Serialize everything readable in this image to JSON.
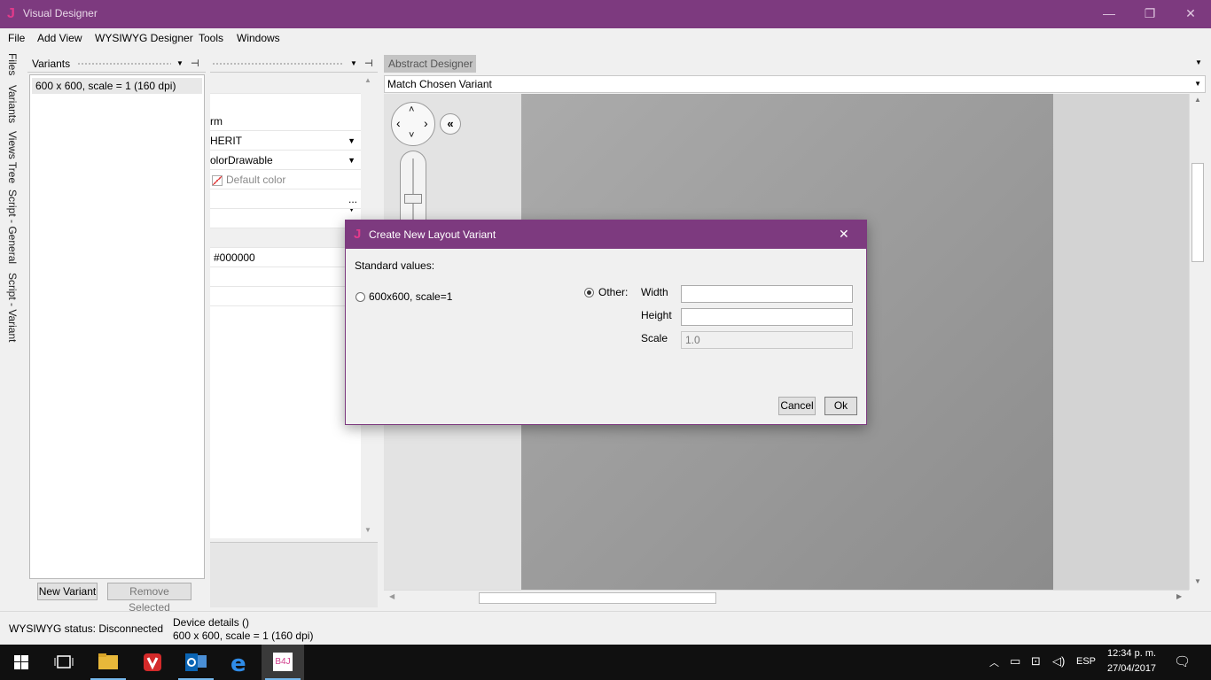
{
  "window": {
    "title": "Visual Designer",
    "app_icon_glyph": "J",
    "minimize_glyph": "—",
    "restore_glyph": "❐",
    "close_glyph": "✕"
  },
  "menu": [
    "File",
    "Add View",
    "WYSIWYG Designer",
    "Tools",
    "Windows"
  ],
  "side_tabs": [
    "Files",
    "Variants",
    "Views Tree",
    "Script - General",
    "Script - Variant"
  ],
  "variants_panel": {
    "title": "Variants",
    "items": [
      "600 x 600, scale = 1 (160 dpi)"
    ],
    "new_button": "New Variant",
    "remove_button": "Remove Selected"
  },
  "properties_panel": {
    "rows": [
      {
        "value": ""
      },
      {
        "value": "rm"
      },
      {
        "value": "HERIT",
        "dropdown": true
      },
      {
        "value": "olorDrawable",
        "dropdown": true
      },
      {
        "value": "Default color"
      },
      {
        "value": "..."
      },
      {
        "value": ""
      },
      {
        "value": ""
      },
      {
        "value": "#000000"
      },
      {
        "value": ""
      },
      {
        "value": ""
      }
    ]
  },
  "designer": {
    "tab_label": "Abstract Designer",
    "variant_select": "Match Chosen Variant",
    "collapse_glyph": "«"
  },
  "status": {
    "wysiwyg": "WYSIWYG status: Disconnected",
    "device_details": "Device details ()",
    "device_variant": "600 x 600, scale = 1 (160 dpi)"
  },
  "dialog": {
    "title": "Create New Layout Variant",
    "icon_glyph": "J",
    "close_glyph": "✕",
    "standard_label": "Standard values:",
    "standard_option": "600x600, scale=1",
    "standard_selected": false,
    "other_label": "Other:",
    "other_selected": true,
    "width_label": "Width",
    "width_value": "",
    "height_label": "Height",
    "height_value": "",
    "scale_label": "Scale",
    "scale_value": "1.0",
    "cancel_button": "Cancel",
    "ok_button": "Ok"
  },
  "taskbar": {
    "language": "ESP",
    "time": "12:34 p. m.",
    "date": "27/04/2017",
    "b4j_label": "B4J"
  },
  "colors": {
    "accent": "#7d3a7f",
    "taskbar": "#101010"
  }
}
